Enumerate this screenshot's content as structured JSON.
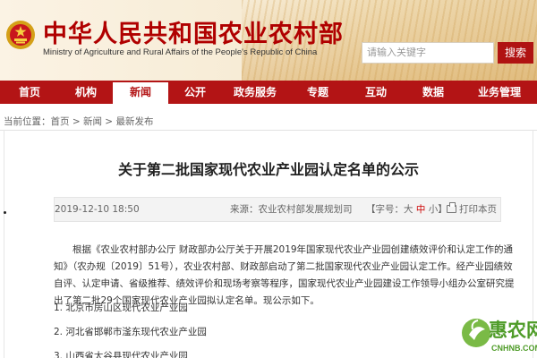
{
  "header": {
    "site_title": "中华人民共和国农业农村部",
    "site_subtitle": "Ministry of Agriculture and Rural Affairs of the People's Republic of China",
    "search_placeholder": "请输入关键字",
    "search_button": "搜索"
  },
  "nav": {
    "items": [
      "首页",
      "机构",
      "新闻",
      "公开",
      "政务服务",
      "专题",
      "互动",
      "数据",
      "业务管理"
    ],
    "active": "新闻"
  },
  "breadcrumb": {
    "prefix": "当前位置：",
    "path": "首页 > 新闻 > 最新发布"
  },
  "article": {
    "title": "关于第二批国家现代农业产业园认定名单的公示",
    "date": "2019-12-10 18:50",
    "source": "来源：农业农村部发展规划司",
    "font_label": "【字号：",
    "font_sizes": [
      "大",
      "中",
      "小"
    ],
    "font_end": "】",
    "print": "打印本页",
    "paragraph": "根据《农业农村部办公厅 财政部办公厅关于开展2019年国家现代农业产业园创建绩效评价和认定工作的通知》（农办规〔2019〕51号），农业农村部、财政部启动了第二批国家现代农业产业园认定工作。经产业园绩效自评、认定申请、省级推荐、绩效评价和现场考察等程序，国家现代农业产业园建设工作领导小组办公室研究提出了第二批29个国家现代农业产业园拟认定名单。现公示如下。",
    "list": [
      "1. 北京市房山区现代农业产业园",
      "2. 河北省邯郸市滏东现代农业产业园",
      "3. 山西省太谷县现代农业产业园"
    ]
  },
  "watermark": {
    "text": "惠农网",
    "url": "CNHNB.COM"
  }
}
